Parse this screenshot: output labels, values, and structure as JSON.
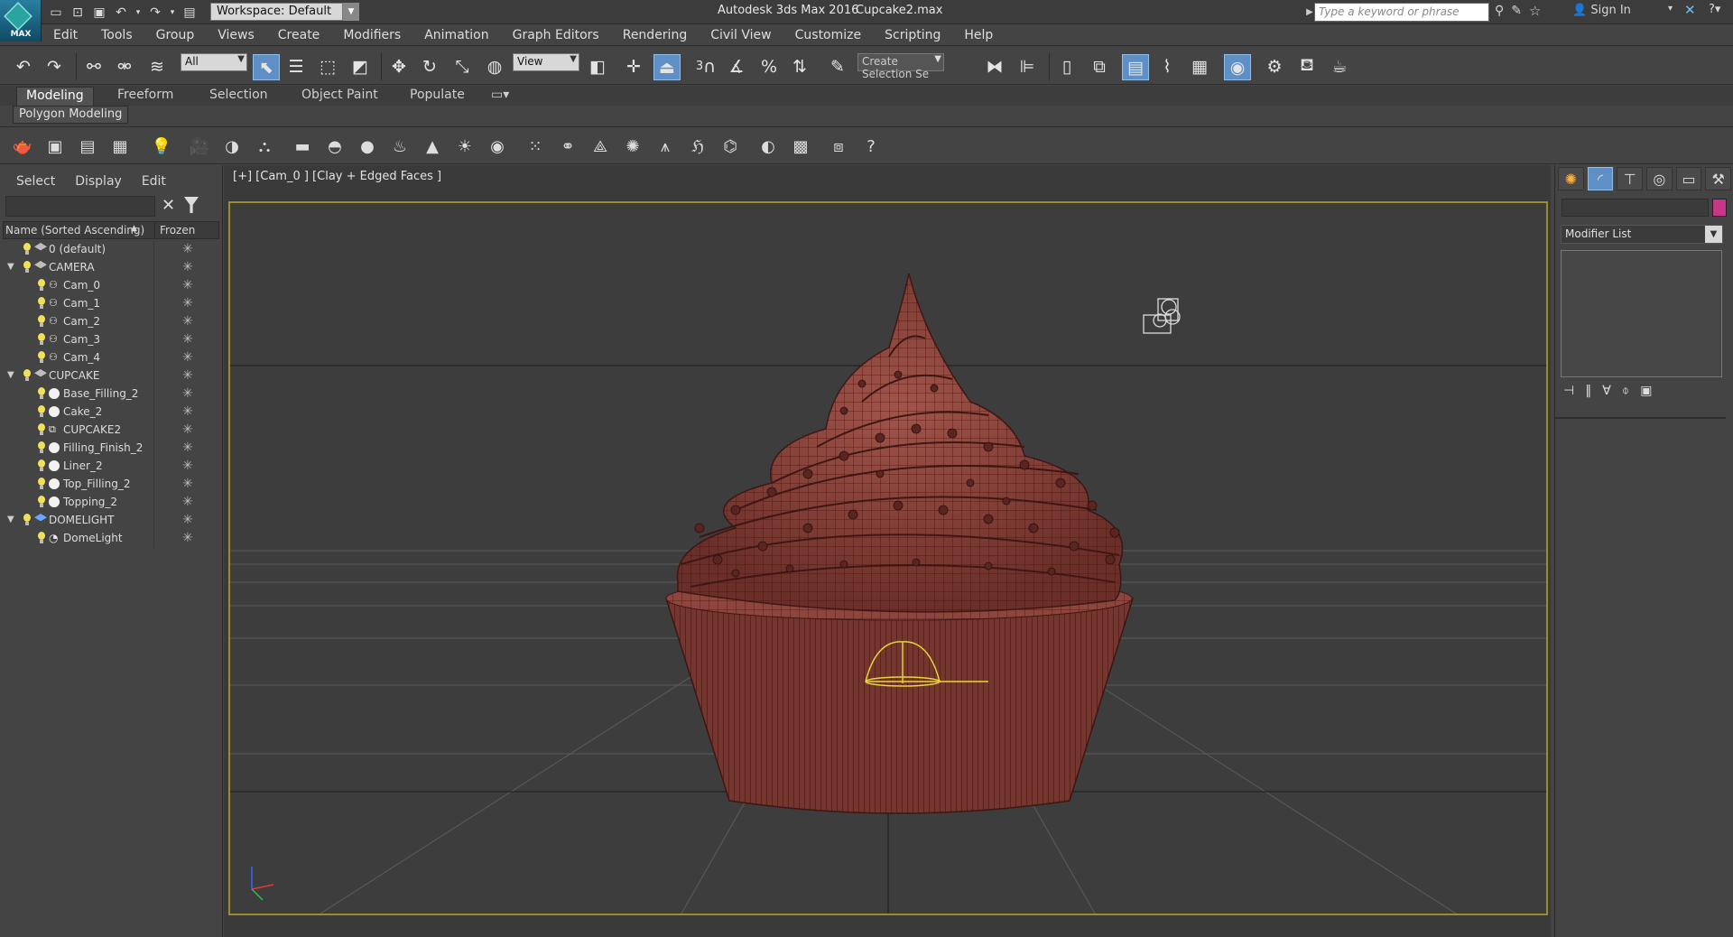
{
  "app": {
    "logo_label": "MAX",
    "title": "Autodesk 3ds Max 2016",
    "file": "Cupcake2.max",
    "workspace": "Workspace: Default",
    "search_placeholder": "Type a keyword or phrase",
    "sign_in": "Sign In"
  },
  "menubar": {
    "items": [
      "Edit",
      "Tools",
      "Group",
      "Views",
      "Create",
      "Modifiers",
      "Animation",
      "Graph Editors",
      "Rendering",
      "Civil View",
      "Customize",
      "Scripting",
      "Help"
    ]
  },
  "main_toolbar": {
    "filter_select": "All",
    "ref_coord_select": "View",
    "selection_set": "Create Selection Se",
    "snap_labels": {
      "snap3": "3",
      "percent": "%"
    }
  },
  "ribbon": {
    "tabs": [
      "Modeling",
      "Freeform",
      "Selection",
      "Object Paint",
      "Populate"
    ],
    "active_tab": "Modeling",
    "panel": "Polygon Modeling"
  },
  "explorer": {
    "menu": [
      "Select",
      "Display",
      "Edit"
    ],
    "col_name": "Name (Sorted Ascending)",
    "col_sort_glyph": "▲",
    "col_frozen": "Frozen",
    "rows": [
      {
        "name": "0 (default)",
        "type": "layer",
        "level": 0,
        "expand": ""
      },
      {
        "name": "CAMERA",
        "type": "layer",
        "level": 0,
        "expand": "▼"
      },
      {
        "name": "Cam_0",
        "type": "cam",
        "level": 1,
        "expand": ""
      },
      {
        "name": "Cam_1",
        "type": "cam",
        "level": 1,
        "expand": ""
      },
      {
        "name": "Cam_2",
        "type": "cam",
        "level": 1,
        "expand": ""
      },
      {
        "name": "Cam_3",
        "type": "cam",
        "level": 1,
        "expand": ""
      },
      {
        "name": "Cam_4",
        "type": "cam",
        "level": 1,
        "expand": ""
      },
      {
        "name": "CUPCAKE",
        "type": "layer",
        "level": 0,
        "expand": "▼"
      },
      {
        "name": "Base_Filling_2",
        "type": "geo",
        "level": 1,
        "expand": ""
      },
      {
        "name": "Cake_2",
        "type": "geo",
        "level": 1,
        "expand": ""
      },
      {
        "name": "CUPCAKE2",
        "type": "group",
        "level": 1,
        "expand": ""
      },
      {
        "name": "Filling_Finish_2",
        "type": "geo",
        "level": 1,
        "expand": ""
      },
      {
        "name": "Liner_2",
        "type": "geo",
        "level": 1,
        "expand": ""
      },
      {
        "name": "Top_Filling_2",
        "type": "geo",
        "level": 1,
        "expand": ""
      },
      {
        "name": "Topping_2",
        "type": "geo",
        "level": 1,
        "expand": ""
      },
      {
        "name": "DOMELIGHT",
        "type": "layer-blue",
        "level": 0,
        "expand": "▼"
      },
      {
        "name": "DomeLight",
        "type": "dome",
        "level": 1,
        "expand": ""
      }
    ]
  },
  "viewport": {
    "label": "[+] [Cam_0 ] [Clay + Edged Faces ]",
    "bg": "#3d3d3d",
    "cupcake_color": "#7a3b34"
  },
  "command_panel": {
    "modifier_list": "Modifier List",
    "swatch_color": "#c8368a"
  }
}
